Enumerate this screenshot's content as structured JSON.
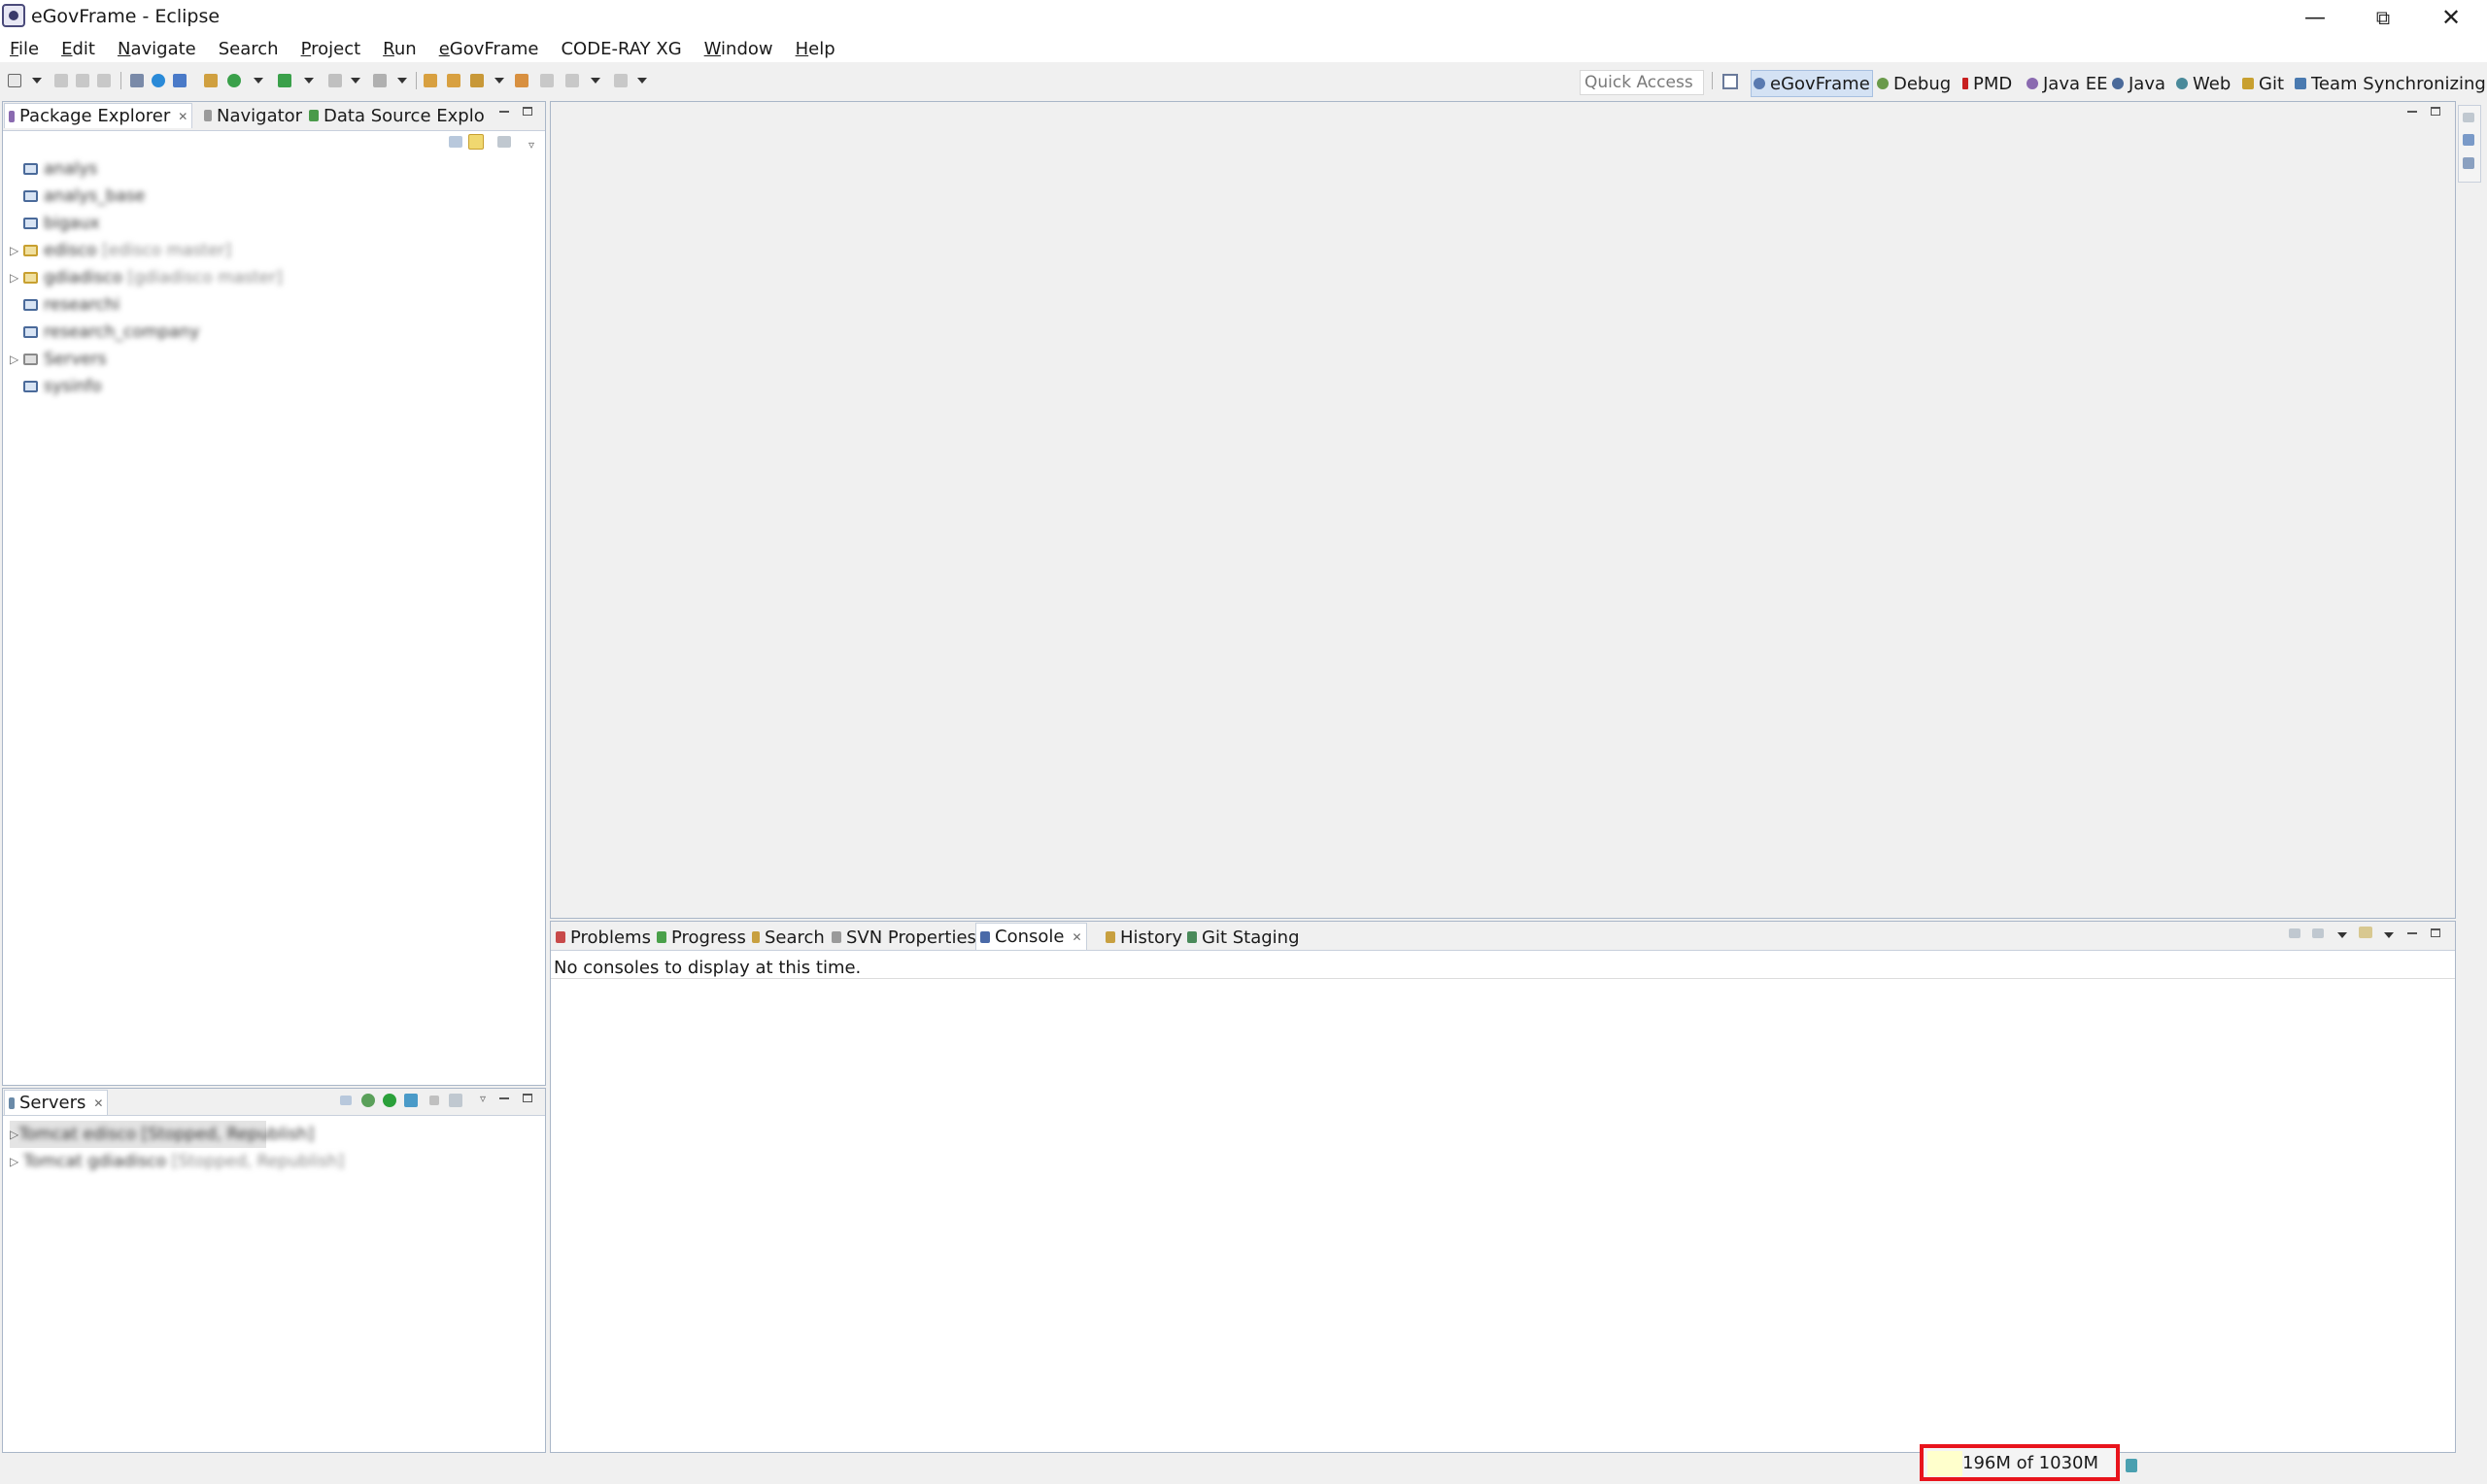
{
  "window": {
    "title": "eGovFrame - Eclipse"
  },
  "menu": {
    "items": [
      {
        "label": "File",
        "mnemonic": "F",
        "rest": "ile"
      },
      {
        "label": "Edit",
        "mnemonic": "E",
        "rest": "dit"
      },
      {
        "label": "Navigate",
        "mnemonic": "N",
        "rest": "avigate"
      },
      {
        "label": "Search",
        "mnemonic": "",
        "rest": "Search"
      },
      {
        "label": "Project",
        "mnemonic": "P",
        "rest": "roject"
      },
      {
        "label": "Run",
        "mnemonic": "R",
        "rest": "un"
      },
      {
        "label": "eGovFrame",
        "mnemonic": "e",
        "rest": "GovFrame"
      },
      {
        "label": "CODE-RAY XG",
        "mnemonic": "",
        "rest": "CODE-RAY XG"
      },
      {
        "label": "Window",
        "mnemonic": "W",
        "rest": "indow"
      },
      {
        "label": "Help",
        "mnemonic": "H",
        "rest": "elp"
      }
    ]
  },
  "toolbar": {
    "quick_access": "Quick Access",
    "perspectives": [
      {
        "label": "eGovFrame",
        "color": "#5a7ab0"
      },
      {
        "label": "Debug",
        "color": "#6a9a4a"
      },
      {
        "label": "PMD",
        "color": "#c82020"
      },
      {
        "label": "Java EE",
        "color": "#8a6ab0"
      },
      {
        "label": "Java",
        "color": "#4a6a9a"
      },
      {
        "label": "Web",
        "color": "#4a8a9a"
      },
      {
        "label": "Git",
        "color": "#c8a030"
      },
      {
        "label": "Team Synchronizing",
        "color": "#4a7ab0"
      }
    ]
  },
  "package_explorer": {
    "tabs": [
      {
        "label": "Package Explorer"
      },
      {
        "label": "Navigator"
      },
      {
        "label": "Data Source Explo"
      }
    ],
    "tree": [
      {
        "name": "analys",
        "extra": "",
        "expandable": false
      },
      {
        "name": "analys_base",
        "extra": "",
        "expandable": false
      },
      {
        "name": "bigaux",
        "extra": "",
        "expandable": false
      },
      {
        "name": "edisco",
        "extra": "[edisco master]",
        "expandable": true
      },
      {
        "name": "gdiadisco",
        "extra": "[gdiadisco master]",
        "expandable": true
      },
      {
        "name": "researchi",
        "extra": "",
        "expandable": false
      },
      {
        "name": "research_company",
        "extra": "",
        "expandable": false
      },
      {
        "name": "Servers",
        "extra": "",
        "expandable": true
      },
      {
        "name": "sysinfo",
        "extra": "",
        "expandable": false
      }
    ]
  },
  "servers": {
    "tab_label": "Servers",
    "rows": [
      {
        "name": "Tomcat edisco",
        "status": "[Stopped, Republish]"
      },
      {
        "name": "Tomcat gdiadisco",
        "status": "[Stopped, Republish]"
      }
    ]
  },
  "console": {
    "tabs": [
      {
        "label": "Problems"
      },
      {
        "label": "Progress"
      },
      {
        "label": "Search"
      },
      {
        "label": "SVN Properties"
      },
      {
        "label": "Console"
      },
      {
        "label": "History"
      },
      {
        "label": "Git Staging"
      }
    ],
    "message": "No consoles to display at this time."
  },
  "status": {
    "heap_text": "196M of 1030M",
    "heap_used_fraction": 0.19
  }
}
